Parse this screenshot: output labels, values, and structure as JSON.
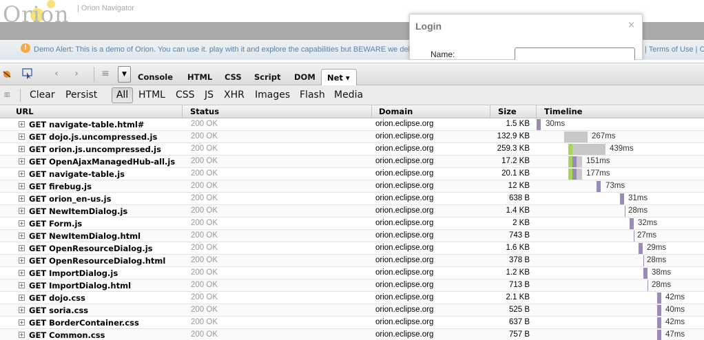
{
  "orion": {
    "logo_text": "Orion",
    "nav_title": "| Orion Navigator",
    "alert_text": "Demo Alert: This is a demo of Orion. You can use it. play with it and explore the capabilities but BEWARE we delete",
    "alert_links": "| Terms of Use | C"
  },
  "login": {
    "title": "Login",
    "close": "×",
    "name_label": "Name:",
    "name_value": ""
  },
  "toolbar": {
    "tabs": [
      "Console",
      "HTML",
      "CSS",
      "Script",
      "DOM"
    ],
    "active_tab": "Net ▾",
    "dropdown": "▼"
  },
  "filters": {
    "clear": "Clear",
    "persist": "Persist",
    "all": "All",
    "types": [
      "HTML",
      "CSS",
      "JS",
      "XHR",
      "Images",
      "Flash",
      "Media"
    ]
  },
  "table": {
    "headers": {
      "url": "URL",
      "status": "Status",
      "domain": "Domain",
      "size": "Size",
      "timeline": "Timeline"
    },
    "rows": [
      {
        "url": "GET navigate-table.html#",
        "status": "200 OK",
        "domain": "orion.eclipse.org",
        "size": "1.5 KB",
        "time": "30ms"
      },
      {
        "url": "GET dojo.js.uncompressed.js",
        "status": "200 OK",
        "domain": "orion.eclipse.org",
        "size": "132.9 KB",
        "time": "267ms"
      },
      {
        "url": "GET orion.js.uncompressed.js",
        "status": "200 OK",
        "domain": "orion.eclipse.org",
        "size": "259.3 KB",
        "time": "439ms"
      },
      {
        "url": "GET OpenAjaxManagedHub-all.js",
        "status": "200 OK",
        "domain": "orion.eclipse.org",
        "size": "17.2 KB",
        "time": "151ms"
      },
      {
        "url": "GET navigate-table.js",
        "status": "200 OK",
        "domain": "orion.eclipse.org",
        "size": "20.1 KB",
        "time": "177ms"
      },
      {
        "url": "GET firebug.js",
        "status": "200 OK",
        "domain": "orion.eclipse.org",
        "size": "12 KB",
        "time": "73ms"
      },
      {
        "url": "GET orion_en-us.js",
        "status": "200 OK",
        "domain": "orion.eclipse.org",
        "size": "638 B",
        "time": "31ms"
      },
      {
        "url": "GET NewItemDialog.js",
        "status": "200 OK",
        "domain": "orion.eclipse.org",
        "size": "1.4 KB",
        "time": "28ms"
      },
      {
        "url": "GET Form.js",
        "status": "200 OK",
        "domain": "orion.eclipse.org",
        "size": "2 KB",
        "time": "32ms"
      },
      {
        "url": "GET NewItemDialog.html",
        "status": "200 OK",
        "domain": "orion.eclipse.org",
        "size": "743 B",
        "time": "27ms"
      },
      {
        "url": "GET OpenResourceDialog.js",
        "status": "200 OK",
        "domain": "orion.eclipse.org",
        "size": "1.6 KB",
        "time": "29ms"
      },
      {
        "url": "GET OpenResourceDialog.html",
        "status": "200 OK",
        "domain": "orion.eclipse.org",
        "size": "378 B",
        "time": "28ms"
      },
      {
        "url": "GET ImportDialog.js",
        "status": "200 OK",
        "domain": "orion.eclipse.org",
        "size": "1.2 KB",
        "time": "38ms"
      },
      {
        "url": "GET ImportDialog.html",
        "status": "200 OK",
        "domain": "orion.eclipse.org",
        "size": "713 B",
        "time": "28ms"
      },
      {
        "url": "GET dojo.css",
        "status": "200 OK",
        "domain": "orion.eclipse.org",
        "size": "2.1 KB",
        "time": "42ms"
      },
      {
        "url": "GET soria.css",
        "status": "200 OK",
        "domain": "orion.eclipse.org",
        "size": "525 B",
        "time": "40ms"
      },
      {
        "url": "GET BorderContainer.css",
        "status": "200 OK",
        "domain": "orion.eclipse.org",
        "size": "637 B",
        "time": "42ms"
      },
      {
        "url": "GET Common.css",
        "status": "200 OK",
        "domain": "orion.eclipse.org",
        "size": "757 B",
        "time": "47ms"
      }
    ]
  },
  "colors": {
    "timeline_wait": "#c8c8c8",
    "timeline_receive": "#9b8bb8",
    "timeline_connect": "#a9d45a",
    "alert": "#f5a94c",
    "link": "#5b82a6"
  }
}
